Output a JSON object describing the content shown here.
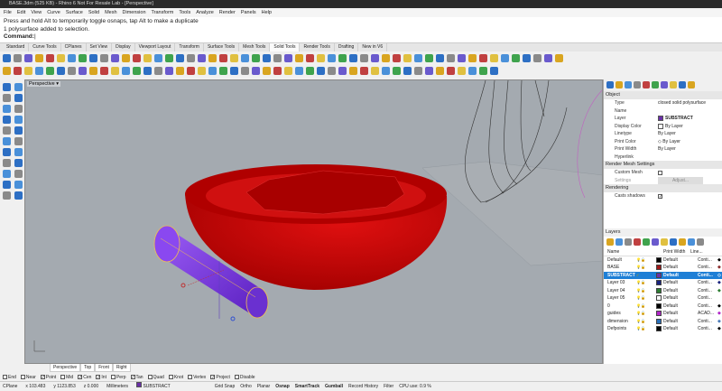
{
  "title": "BASE.3dm (525 KB) - Rhino 6 Not For Resale Lab - [Perspective]",
  "menu": [
    "File",
    "Edit",
    "View",
    "Curve",
    "Surface",
    "Solid",
    "Mesh",
    "Dimension",
    "Transform",
    "Tools",
    "Analyze",
    "Render",
    "Panels",
    "Help"
  ],
  "command": {
    "line1": "Press and hold Alt to temporarily toggle osnaps, tap Alt to make a duplicate",
    "line2": "1 polysurface added to selection.",
    "prompt": "Command:"
  },
  "toolbar_tabs": [
    "Standard",
    "Curve Tools",
    "CPlanes",
    "Set View",
    "Display",
    "Viewport Layout",
    "Transform",
    "Surface Tools",
    "Mesh Tools",
    "Solid Tools",
    "Render Tools",
    "Drafting",
    "New in V6"
  ],
  "active_toolbar_tab": "Solid Tools",
  "viewport": {
    "label": "Perspective",
    "menu_icon": "triangle-down"
  },
  "viewport_tabs": [
    "Perspective",
    "Top",
    "Front",
    "Right"
  ],
  "properties": {
    "section_object": "Object",
    "rows": [
      {
        "k": "Type",
        "v": "closed solid polysurface"
      },
      {
        "k": "Name",
        "v": ""
      },
      {
        "k": "Layer",
        "v": "SUBSTRACT",
        "swatch": "#6a2fa8"
      },
      {
        "k": "Display Color",
        "v": "By Layer",
        "swatch": "#ffffff"
      },
      {
        "k": "Linetype",
        "v": "By Layer"
      },
      {
        "k": "Print Color",
        "v": "◇ By Layer"
      },
      {
        "k": "Print Width",
        "v": "By Layer"
      },
      {
        "k": "Hyperlink",
        "v": ""
      }
    ],
    "section_mesh": "Render Mesh Settings",
    "custom_mesh": "Custom Mesh",
    "settings": "Settings",
    "adjust": "Adjust...",
    "section_render": "Rendering",
    "casts_shadows": "Casts shadows"
  },
  "layers": {
    "title": "Layers",
    "headers": {
      "name": "Name",
      "print_width": "Print Width",
      "linetype": "Line..."
    },
    "rows": [
      {
        "name": "Default",
        "color": "#000000",
        "pw": "Default",
        "lt": "Conti...",
        "mat": "#000000"
      },
      {
        "name": "BASE",
        "color": "#a01818",
        "pw": "Default",
        "lt": "Conti...",
        "mat": "#8a2a2a"
      },
      {
        "name": "SUBSTRACT",
        "color": "#6a2fa8",
        "pw": "Default",
        "lt": "Conti...",
        "mat": "#ffffff",
        "selected": true
      },
      {
        "name": "Layer 03",
        "color": "#1a237e",
        "pw": "Default",
        "lt": "Conti...",
        "mat": "#1a237e"
      },
      {
        "name": "Layer 04",
        "color": "#2e7d32",
        "pw": "Default",
        "lt": "Conti...",
        "mat": "#2e7d32"
      },
      {
        "name": "Layer 05",
        "color": "#ffffff",
        "pw": "Default",
        "lt": "Conti...",
        "mat": "#ffffff"
      },
      {
        "name": "0",
        "color": "#000000",
        "pw": "Default",
        "lt": "Conti...",
        "mat": "#000000"
      },
      {
        "name": "guides",
        "color": "#b026c8",
        "pw": "Default",
        "lt": "ACAD...",
        "mat": "#b026c8"
      },
      {
        "name": "dimension",
        "color": "#2a6fb8",
        "pw": "Default",
        "lt": "Conti...",
        "mat": "#4a7ab8"
      },
      {
        "name": "Defpoints",
        "color": "#000000",
        "pw": "Default",
        "lt": "Conti...",
        "mat": "#000000"
      }
    ]
  },
  "osnaps": [
    {
      "l": "End",
      "on": false
    },
    {
      "l": "Near",
      "on": false
    },
    {
      "l": "Point",
      "on": true
    },
    {
      "l": "Mid",
      "on": false
    },
    {
      "l": "Cen",
      "on": true
    },
    {
      "l": "Int",
      "on": true
    },
    {
      "l": "Perp",
      "on": false
    },
    {
      "l": "Tan",
      "on": true
    },
    {
      "l": "Quad",
      "on": false
    },
    {
      "l": "Knot",
      "on": false
    },
    {
      "l": "Vertex",
      "on": false
    },
    {
      "l": "Project",
      "on": true
    },
    {
      "l": "Disable",
      "on": false
    }
  ],
  "status": {
    "cplane": "CPlane",
    "x": "x 103.483",
    "y": "y 1123.853",
    "z": "z 0.000",
    "units": "Millimeters",
    "layer": "SUBSTRACT",
    "layer_color": "#6a2fa8",
    "items": [
      {
        "l": "Grid Snap",
        "b": false
      },
      {
        "l": "Ortho",
        "b": false
      },
      {
        "l": "Planar",
        "b": false
      },
      {
        "l": "Osnap",
        "b": true
      },
      {
        "l": "SmartTrack",
        "b": true
      },
      {
        "l": "Gumball",
        "b": true
      },
      {
        "l": "Record History",
        "b": false
      },
      {
        "l": "Filter",
        "b": false
      },
      {
        "l": "CPU use: 0.9 %",
        "b": false
      }
    ]
  },
  "colors": {
    "object_red": "#c80000",
    "selected_purple": "#7a2fe0",
    "viewport_bg": "#a4aab0",
    "selection_blue": "#1e7fd6"
  }
}
